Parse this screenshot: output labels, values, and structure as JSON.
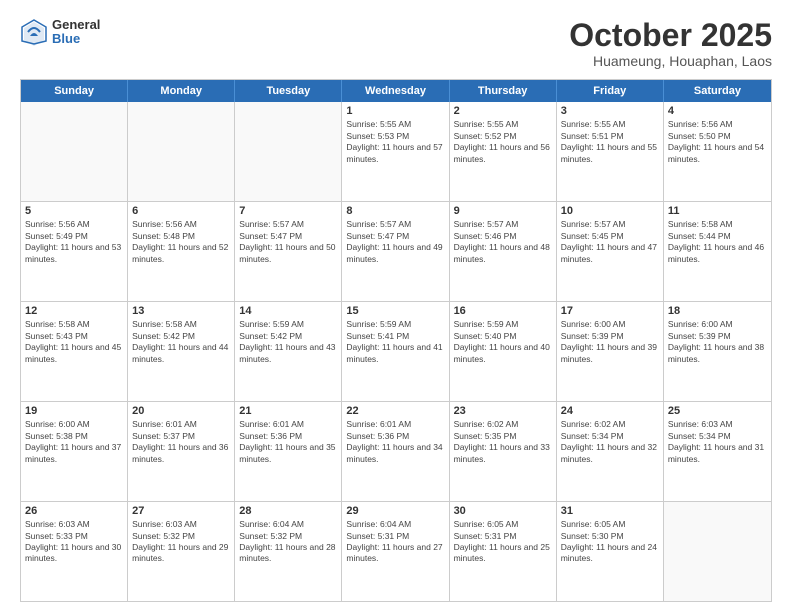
{
  "logo": {
    "general": "General",
    "blue": "Blue"
  },
  "title": "October 2025",
  "subtitle": "Huameung, Houaphan, Laos",
  "header_days": [
    "Sunday",
    "Monday",
    "Tuesday",
    "Wednesday",
    "Thursday",
    "Friday",
    "Saturday"
  ],
  "weeks": [
    [
      {
        "day": "",
        "info": ""
      },
      {
        "day": "",
        "info": ""
      },
      {
        "day": "",
        "info": ""
      },
      {
        "day": "1",
        "info": "Sunrise: 5:55 AM\nSunset: 5:53 PM\nDaylight: 11 hours and 57 minutes."
      },
      {
        "day": "2",
        "info": "Sunrise: 5:55 AM\nSunset: 5:52 PM\nDaylight: 11 hours and 56 minutes."
      },
      {
        "day": "3",
        "info": "Sunrise: 5:55 AM\nSunset: 5:51 PM\nDaylight: 11 hours and 55 minutes."
      },
      {
        "day": "4",
        "info": "Sunrise: 5:56 AM\nSunset: 5:50 PM\nDaylight: 11 hours and 54 minutes."
      }
    ],
    [
      {
        "day": "5",
        "info": "Sunrise: 5:56 AM\nSunset: 5:49 PM\nDaylight: 11 hours and 53 minutes."
      },
      {
        "day": "6",
        "info": "Sunrise: 5:56 AM\nSunset: 5:48 PM\nDaylight: 11 hours and 52 minutes."
      },
      {
        "day": "7",
        "info": "Sunrise: 5:57 AM\nSunset: 5:47 PM\nDaylight: 11 hours and 50 minutes."
      },
      {
        "day": "8",
        "info": "Sunrise: 5:57 AM\nSunset: 5:47 PM\nDaylight: 11 hours and 49 minutes."
      },
      {
        "day": "9",
        "info": "Sunrise: 5:57 AM\nSunset: 5:46 PM\nDaylight: 11 hours and 48 minutes."
      },
      {
        "day": "10",
        "info": "Sunrise: 5:57 AM\nSunset: 5:45 PM\nDaylight: 11 hours and 47 minutes."
      },
      {
        "day": "11",
        "info": "Sunrise: 5:58 AM\nSunset: 5:44 PM\nDaylight: 11 hours and 46 minutes."
      }
    ],
    [
      {
        "day": "12",
        "info": "Sunrise: 5:58 AM\nSunset: 5:43 PM\nDaylight: 11 hours and 45 minutes."
      },
      {
        "day": "13",
        "info": "Sunrise: 5:58 AM\nSunset: 5:42 PM\nDaylight: 11 hours and 44 minutes."
      },
      {
        "day": "14",
        "info": "Sunrise: 5:59 AM\nSunset: 5:42 PM\nDaylight: 11 hours and 43 minutes."
      },
      {
        "day": "15",
        "info": "Sunrise: 5:59 AM\nSunset: 5:41 PM\nDaylight: 11 hours and 41 minutes."
      },
      {
        "day": "16",
        "info": "Sunrise: 5:59 AM\nSunset: 5:40 PM\nDaylight: 11 hours and 40 minutes."
      },
      {
        "day": "17",
        "info": "Sunrise: 6:00 AM\nSunset: 5:39 PM\nDaylight: 11 hours and 39 minutes."
      },
      {
        "day": "18",
        "info": "Sunrise: 6:00 AM\nSunset: 5:39 PM\nDaylight: 11 hours and 38 minutes."
      }
    ],
    [
      {
        "day": "19",
        "info": "Sunrise: 6:00 AM\nSunset: 5:38 PM\nDaylight: 11 hours and 37 minutes."
      },
      {
        "day": "20",
        "info": "Sunrise: 6:01 AM\nSunset: 5:37 PM\nDaylight: 11 hours and 36 minutes."
      },
      {
        "day": "21",
        "info": "Sunrise: 6:01 AM\nSunset: 5:36 PM\nDaylight: 11 hours and 35 minutes."
      },
      {
        "day": "22",
        "info": "Sunrise: 6:01 AM\nSunset: 5:36 PM\nDaylight: 11 hours and 34 minutes."
      },
      {
        "day": "23",
        "info": "Sunrise: 6:02 AM\nSunset: 5:35 PM\nDaylight: 11 hours and 33 minutes."
      },
      {
        "day": "24",
        "info": "Sunrise: 6:02 AM\nSunset: 5:34 PM\nDaylight: 11 hours and 32 minutes."
      },
      {
        "day": "25",
        "info": "Sunrise: 6:03 AM\nSunset: 5:34 PM\nDaylight: 11 hours and 31 minutes."
      }
    ],
    [
      {
        "day": "26",
        "info": "Sunrise: 6:03 AM\nSunset: 5:33 PM\nDaylight: 11 hours and 30 minutes."
      },
      {
        "day": "27",
        "info": "Sunrise: 6:03 AM\nSunset: 5:32 PM\nDaylight: 11 hours and 29 minutes."
      },
      {
        "day": "28",
        "info": "Sunrise: 6:04 AM\nSunset: 5:32 PM\nDaylight: 11 hours and 28 minutes."
      },
      {
        "day": "29",
        "info": "Sunrise: 6:04 AM\nSunset: 5:31 PM\nDaylight: 11 hours and 27 minutes."
      },
      {
        "day": "30",
        "info": "Sunrise: 6:05 AM\nSunset: 5:31 PM\nDaylight: 11 hours and 25 minutes."
      },
      {
        "day": "31",
        "info": "Sunrise: 6:05 AM\nSunset: 5:30 PM\nDaylight: 11 hours and 24 minutes."
      },
      {
        "day": "",
        "info": ""
      }
    ]
  ]
}
